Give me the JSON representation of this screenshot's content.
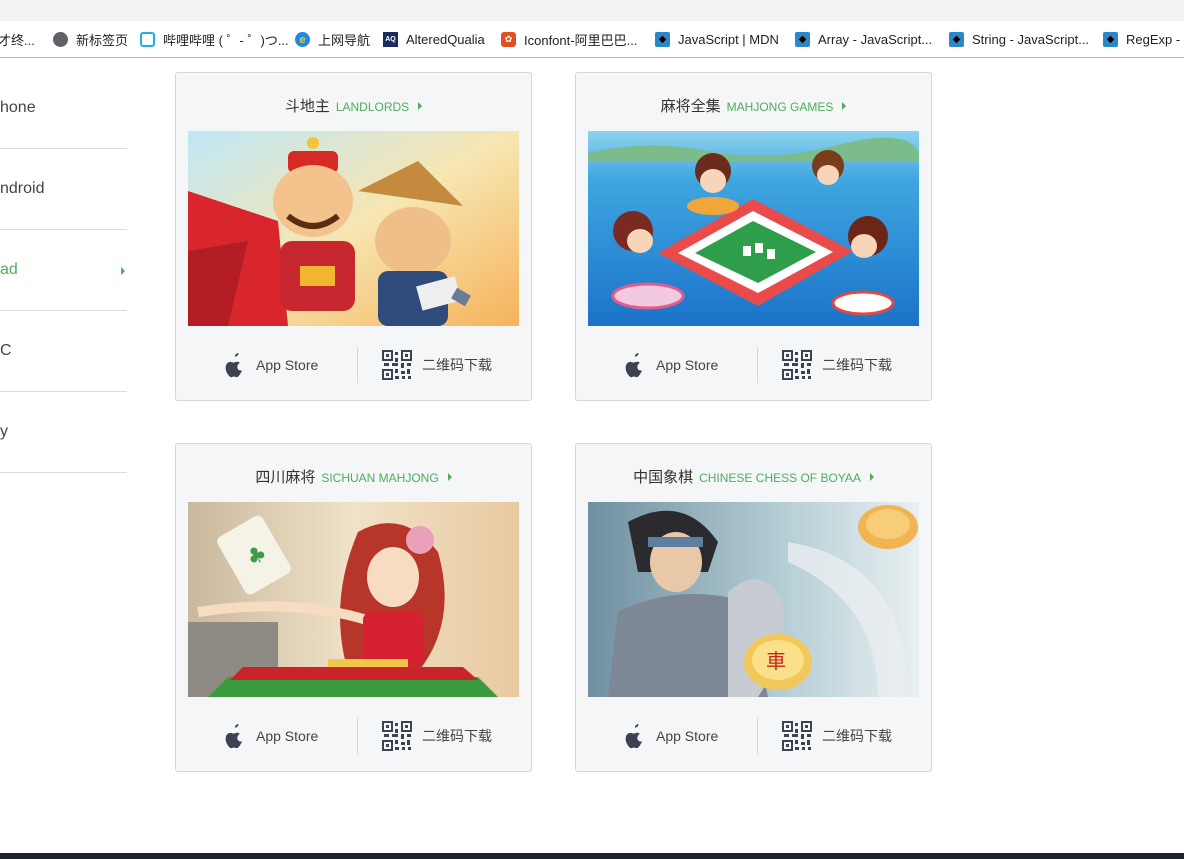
{
  "bookmarks": [
    {
      "label": "才终...",
      "icon": "page-icon"
    },
    {
      "label": "新标签页",
      "icon": "globe-icon"
    },
    {
      "label": "哔哩哔哩 ( ゜- ゜)つ...",
      "icon": "bilibili-icon"
    },
    {
      "label": "上网导航",
      "icon": "ie-icon"
    },
    {
      "label": "AlteredQualia",
      "icon": "aq-icon"
    },
    {
      "label": "Iconfont-阿里巴巴...",
      "icon": "iconfont-icon"
    },
    {
      "label": "JavaScript | MDN",
      "icon": "mdn-icon"
    },
    {
      "label": "Array - JavaScript...",
      "icon": "mdn-icon"
    },
    {
      "label": "String - JavaScript...",
      "icon": "mdn-icon"
    },
    {
      "label": "RegExp - J",
      "icon": "mdn-icon"
    }
  ],
  "nav": {
    "items": [
      {
        "label": "hone",
        "active": false
      },
      {
        "label": "ndroid",
        "active": false
      },
      {
        "label": "ad",
        "active": true
      },
      {
        "label": "C",
        "active": false
      },
      {
        "label": "y",
        "active": false
      }
    ]
  },
  "colors": {
    "accent": "#4cad5b",
    "card_bg": "#f5f6f8",
    "border": "#d3d7dc"
  },
  "games": [
    {
      "title_cn": "斗地主",
      "title_en": "LANDLORDS",
      "appstore_label": "App Store",
      "qr_label": "二维码下载"
    },
    {
      "title_cn": "麻将全集",
      "title_en": "MAHJONG GAMES",
      "appstore_label": "App Store",
      "qr_label": "二维码下载"
    },
    {
      "title_cn": "四川麻将",
      "title_en": "SICHUAN MAHJONG",
      "appstore_label": "App Store",
      "qr_label": "二维码下载"
    },
    {
      "title_cn": "中国象棋",
      "title_en": "CHINESE CHESS OF BOYAA",
      "appstore_label": "App Store",
      "qr_label": "二维码下载"
    }
  ]
}
